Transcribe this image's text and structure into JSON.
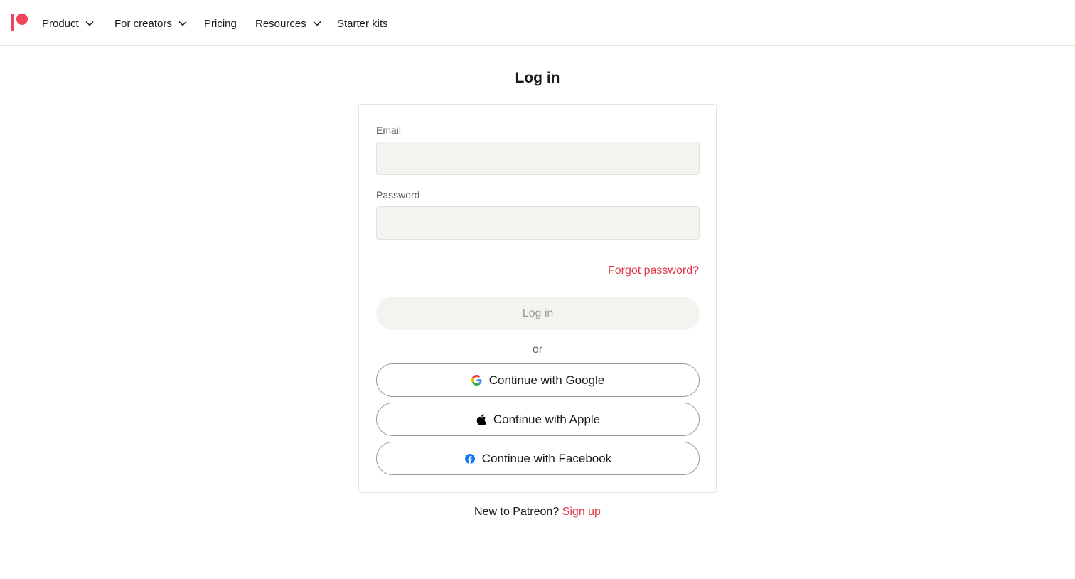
{
  "nav": {
    "items": [
      {
        "label": "Product",
        "has_dropdown": true
      },
      {
        "label": "For creators",
        "has_dropdown": true
      },
      {
        "label": "Pricing",
        "has_dropdown": false
      },
      {
        "label": "Resources",
        "has_dropdown": true
      },
      {
        "label": "Starter kits",
        "has_dropdown": false
      }
    ]
  },
  "login": {
    "title": "Log in",
    "email_label": "Email",
    "email_value": "",
    "password_label": "Password",
    "password_value": "",
    "forgot_password": "Forgot password?",
    "submit_label": "Log in",
    "or_label": "or",
    "social": {
      "google": "Continue with Google",
      "apple": "Continue with Apple",
      "facebook": "Continue with Facebook"
    }
  },
  "footer": {
    "new_prompt": "New to Patreon?",
    "signup_link": "Sign up"
  },
  "colors": {
    "brand": "#f1465a",
    "link": "#e0394d",
    "input_bg": "#f4f3ef",
    "facebook": "#1877f2"
  },
  "icons": {
    "logo": "patreon-logo-icon",
    "dropdown": "chevron-down-icon",
    "google": "google-icon",
    "apple": "apple-icon",
    "facebook": "facebook-icon"
  }
}
